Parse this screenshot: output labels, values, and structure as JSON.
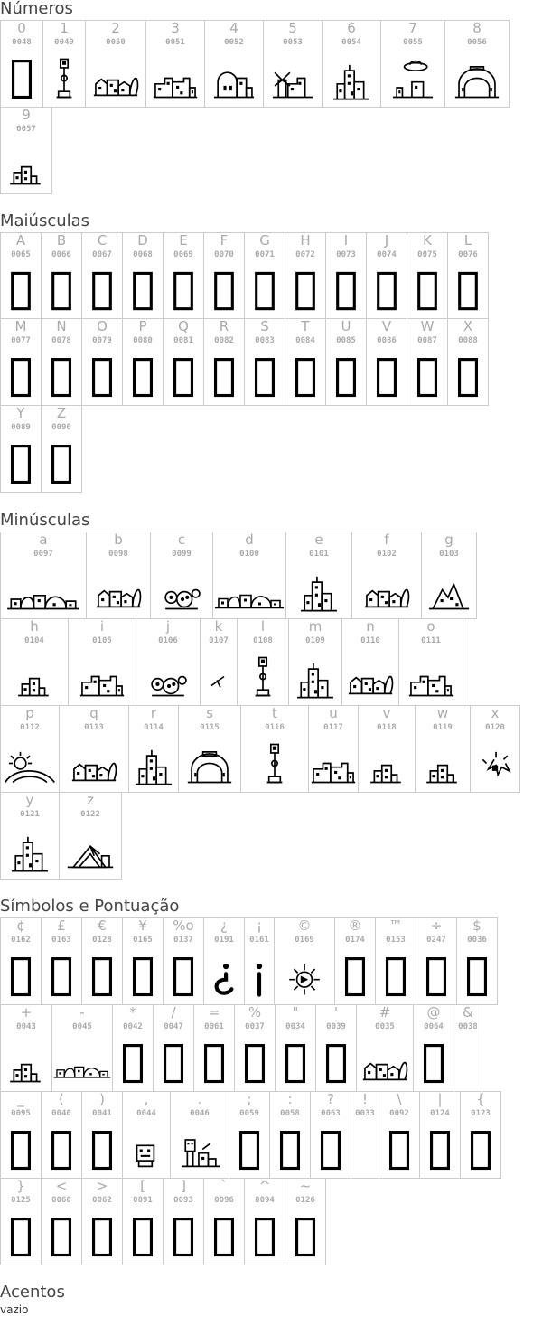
{
  "sections": [
    {
      "id": "numeros",
      "title": "Números",
      "rows": [
        {
          "heights": 96,
          "cells": [
            {
              "char": "0",
              "code": "0048",
              "glyph": "notdef"
            },
            {
              "char": "1",
              "code": "0049",
              "glyph": "lamp-post"
            },
            {
              "char": "2",
              "code": "0050",
              "glyph": "city-tree"
            },
            {
              "char": "3",
              "code": "0051",
              "glyph": "city-low"
            },
            {
              "char": "4",
              "code": "0052",
              "glyph": "city-dome"
            },
            {
              "char": "5",
              "code": "0053",
              "glyph": "city-windmill"
            },
            {
              "char": "6",
              "code": "0054",
              "glyph": "city-tower"
            },
            {
              "char": "7",
              "code": "0055",
              "glyph": "ufo-city"
            },
            {
              "char": "8",
              "code": "0056",
              "glyph": "city-arch"
            }
          ]
        },
        {
          "cells": [
            {
              "char": "9",
              "code": "0057",
              "glyph": "city-small"
            }
          ]
        }
      ]
    },
    {
      "id": "maiusculas",
      "title": "Maiúsculas",
      "rows": [
        {
          "cells": [
            {
              "char": "A",
              "code": "0065",
              "glyph": "notdef"
            },
            {
              "char": "B",
              "code": "0066",
              "glyph": "notdef"
            },
            {
              "char": "C",
              "code": "0067",
              "glyph": "notdef"
            },
            {
              "char": "D",
              "code": "0068",
              "glyph": "notdef"
            },
            {
              "char": "E",
              "code": "0069",
              "glyph": "notdef"
            },
            {
              "char": "F",
              "code": "0070",
              "glyph": "notdef"
            },
            {
              "char": "G",
              "code": "0071",
              "glyph": "notdef"
            },
            {
              "char": "H",
              "code": "0072",
              "glyph": "notdef"
            },
            {
              "char": "I",
              "code": "0073",
              "glyph": "notdef"
            },
            {
              "char": "J",
              "code": "0074",
              "glyph": "notdef"
            },
            {
              "char": "K",
              "code": "0075",
              "glyph": "notdef"
            },
            {
              "char": "L",
              "code": "0076",
              "glyph": "notdef"
            }
          ]
        },
        {
          "cells": [
            {
              "char": "M",
              "code": "0077",
              "glyph": "notdef"
            },
            {
              "char": "N",
              "code": "0078",
              "glyph": "notdef"
            },
            {
              "char": "O",
              "code": "0079",
              "glyph": "notdef"
            },
            {
              "char": "P",
              "code": "0080",
              "glyph": "notdef"
            },
            {
              "char": "Q",
              "code": "0081",
              "glyph": "notdef"
            },
            {
              "char": "R",
              "code": "0082",
              "glyph": "notdef"
            },
            {
              "char": "S",
              "code": "0083",
              "glyph": "notdef"
            },
            {
              "char": "T",
              "code": "0084",
              "glyph": "notdef"
            },
            {
              "char": "U",
              "code": "0085",
              "glyph": "notdef"
            },
            {
              "char": "V",
              "code": "0086",
              "glyph": "notdef"
            },
            {
              "char": "W",
              "code": "0087",
              "glyph": "notdef"
            },
            {
              "char": "X",
              "code": "0088",
              "glyph": "notdef"
            }
          ]
        },
        {
          "cells": [
            {
              "char": "Y",
              "code": "0089",
              "glyph": "notdef"
            },
            {
              "char": "Z",
              "code": "0090",
              "glyph": "notdef"
            }
          ]
        }
      ]
    },
    {
      "id": "minusculas",
      "title": "Minúsculas",
      "rows": [
        {
          "cells": [
            {
              "char": "a",
              "code": "0097",
              "glyph": "city-wide"
            },
            {
              "char": "b",
              "code": "0098",
              "glyph": "city-tree"
            },
            {
              "char": "c",
              "code": "0099",
              "glyph": "city-round"
            },
            {
              "char": "d",
              "code": "0100",
              "glyph": "city-wide"
            },
            {
              "char": "e",
              "code": "0101",
              "glyph": "city-tower"
            },
            {
              "char": "f",
              "code": "0102",
              "glyph": "city-tree"
            },
            {
              "char": "g",
              "code": "0103",
              "glyph": "city-peak"
            }
          ]
        },
        {
          "cells": [
            {
              "char": "h",
              "code": "0104",
              "glyph": "city-small"
            },
            {
              "char": "i",
              "code": "0105",
              "glyph": "city-low"
            },
            {
              "char": "j",
              "code": "0106",
              "glyph": "city-round"
            },
            {
              "char": "k",
              "code": "0107",
              "glyph": "bird"
            },
            {
              "char": "l",
              "code": "0108",
              "glyph": "lamp-post"
            },
            {
              "char": "m",
              "code": "0109",
              "glyph": "city-tower"
            },
            {
              "char": "n",
              "code": "0110",
              "glyph": "city-tree"
            },
            {
              "char": "o",
              "code": "0111",
              "glyph": "city-low"
            }
          ]
        },
        {
          "cells": [
            {
              "char": "p",
              "code": "0112",
              "glyph": "sun-hill"
            },
            {
              "char": "q",
              "code": "0113",
              "glyph": "city-tree"
            },
            {
              "char": "r",
              "code": "0114",
              "glyph": "city-tower"
            },
            {
              "char": "s",
              "code": "0115",
              "glyph": "city-arch"
            },
            {
              "char": "t",
              "code": "0116",
              "glyph": "lamp-post"
            },
            {
              "char": "u",
              "code": "0117",
              "glyph": "city-low"
            },
            {
              "char": "v",
              "code": "0118",
              "glyph": "city-small"
            },
            {
              "char": "w",
              "code": "0119",
              "glyph": "city-small"
            },
            {
              "char": "x",
              "code": "0120",
              "glyph": "splash"
            }
          ]
        },
        {
          "cells": [
            {
              "char": "y",
              "code": "0121",
              "glyph": "city-tower"
            },
            {
              "char": "z",
              "code": "0122",
              "glyph": "opera"
            }
          ]
        }
      ]
    },
    {
      "id": "simbolos",
      "title": "Símbolos e Pontuação",
      "rows": [
        {
          "cells": [
            {
              "char": "¢",
              "code": "0162",
              "glyph": "notdef"
            },
            {
              "char": "£",
              "code": "0163",
              "glyph": "notdef"
            },
            {
              "char": "€",
              "code": "0128",
              "glyph": "notdef"
            },
            {
              "char": "¥",
              "code": "0165",
              "glyph": "notdef"
            },
            {
              "char": "%o",
              "code": "0137",
              "glyph": "notdef"
            },
            {
              "char": "¿",
              "code": "0191",
              "glyph": "inv-question"
            },
            {
              "char": "¡",
              "code": "0161",
              "glyph": "inv-exclaim"
            },
            {
              "char": "©",
              "code": "0169",
              "glyph": "sun-ring"
            },
            {
              "char": "®",
              "code": "0174",
              "glyph": "notdef"
            },
            {
              "char": "™",
              "code": "0153",
              "glyph": "notdef"
            },
            {
              "char": "÷",
              "code": "0247",
              "glyph": "notdef"
            },
            {
              "char": "$",
              "code": "0036",
              "glyph": "notdef"
            }
          ]
        },
        {
          "cells": [
            {
              "char": "+",
              "code": "0043",
              "glyph": "city-small"
            },
            {
              "char": "-",
              "code": "0045",
              "glyph": "city-wide"
            },
            {
              "char": "*",
              "code": "0042",
              "glyph": "notdef"
            },
            {
              "char": "/",
              "code": "0047",
              "glyph": "notdef"
            },
            {
              "char": "=",
              "code": "0061",
              "glyph": "notdef"
            },
            {
              "char": "%",
              "code": "0037",
              "glyph": "notdef"
            },
            {
              "char": "\"",
              "code": "0034",
              "glyph": "notdef"
            },
            {
              "char": "'",
              "code": "0039",
              "glyph": "notdef"
            },
            {
              "char": "#",
              "code": "0035",
              "glyph": "city-tree"
            },
            {
              "char": "@",
              "code": "0064",
              "glyph": "notdef"
            },
            {
              "char": "&",
              "code": "0038",
              "glyph": "blank"
            }
          ]
        },
        {
          "cells": [
            {
              "char": "_",
              "code": "0095",
              "glyph": "notdef"
            },
            {
              "char": "(",
              "code": "0040",
              "glyph": "notdef"
            },
            {
              "char": ")",
              "code": "0041",
              "glyph": "notdef"
            },
            {
              "char": ",",
              "code": "0044",
              "glyph": "face-box"
            },
            {
              "char": ".",
              "code": "0046",
              "glyph": "robot-city"
            },
            {
              "char": ";",
              "code": "0059",
              "glyph": "notdef"
            },
            {
              "char": ":",
              "code": "0058",
              "glyph": "notdef"
            },
            {
              "char": "?",
              "code": "0063",
              "glyph": "notdef"
            },
            {
              "char": "!",
              "code": "0033",
              "glyph": "blank"
            },
            {
              "char": "\\",
              "code": "0092",
              "glyph": "notdef"
            },
            {
              "char": "|",
              "code": "0124",
              "glyph": "notdef"
            },
            {
              "char": "{",
              "code": "0123",
              "glyph": "notdef"
            }
          ]
        },
        {
          "cells": [
            {
              "char": "}",
              "code": "0125",
              "glyph": "notdef"
            },
            {
              "char": "<",
              "code": "0060",
              "glyph": "notdef"
            },
            {
              "char": ">",
              "code": "0062",
              "glyph": "notdef"
            },
            {
              "char": "[",
              "code": "0091",
              "glyph": "notdef"
            },
            {
              "char": "]",
              "code": "0093",
              "glyph": "notdef"
            },
            {
              "char": "`",
              "code": "0096",
              "glyph": "notdef"
            },
            {
              "char": "^",
              "code": "0094",
              "glyph": "notdef"
            },
            {
              "char": "~",
              "code": "0126",
              "glyph": "notdef"
            }
          ]
        }
      ]
    },
    {
      "id": "acentos",
      "title": "Acentos",
      "empty_text": "vazio",
      "rows": []
    }
  ]
}
